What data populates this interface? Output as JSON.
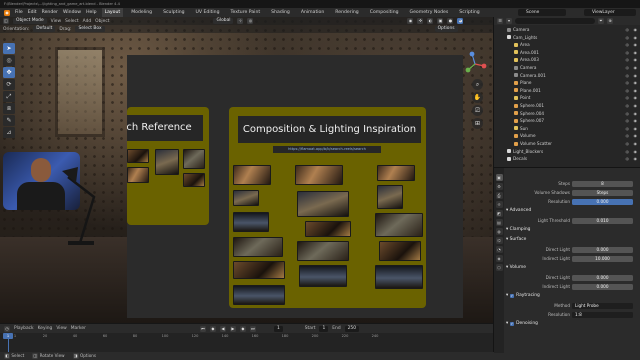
{
  "title_bar": "F:\\Blender\\Projects\\...\\lighting_and_game_art.blend - Blender 4.4",
  "menu": {
    "items": [
      "File",
      "Edit",
      "Render",
      "Window",
      "Help"
    ],
    "workspaces": [
      "Layout",
      "Modeling",
      "Sculpting",
      "UV Editing",
      "Texture Paint",
      "Shading",
      "Animation",
      "Rendering",
      "Compositing",
      "Geometry Nodes",
      "Scripting"
    ],
    "active_workspace": "Layout",
    "scene": "Scene",
    "view_layer": "ViewLayer"
  },
  "viewport": {
    "header1": {
      "mode": "Object Mode",
      "menus": [
        "View",
        "Select",
        "Add",
        "Object"
      ],
      "transform": "Global"
    },
    "header2": {
      "orientation_label": "Orientation:",
      "orientation_value": "Default",
      "drag_label": "Drag:",
      "drag_value": "Select Box",
      "options": "Options"
    },
    "tools": [
      "➤",
      "◎",
      "✥",
      "⟳",
      "⤢",
      "⧈",
      "✎",
      "⊿"
    ]
  },
  "reference_board": {
    "left_title": "nch Reference",
    "right_title": "Composition & Lighting Inspiration",
    "right_link": "https://flamoat.app/b/b/search-reels/search"
  },
  "timeline": {
    "menus": [
      "Playback",
      "Keying",
      "View",
      "Marker"
    ],
    "current_frame": "1",
    "start_label": "Start",
    "start_value": "1",
    "end_label": "End",
    "end_value": "250",
    "ruler": [
      "1",
      "20",
      "40",
      "60",
      "80",
      "100",
      "120",
      "140",
      "160",
      "180",
      "200",
      "220",
      "240"
    ]
  },
  "status_bar": {
    "items": [
      "Select",
      "Rotate View",
      "Options"
    ]
  },
  "outliner": {
    "rows": [
      {
        "name": "Camera",
        "color": "#8b8b8b",
        "indent": 1
      },
      {
        "name": "Cam_Lights",
        "color": "#d9d9d9",
        "indent": 1
      },
      {
        "name": "Area",
        "color": "#e2c25a",
        "indent": 2
      },
      {
        "name": "Area.001",
        "color": "#e2c25a",
        "indent": 2
      },
      {
        "name": "Area.003",
        "color": "#e2c25a",
        "indent": 2
      },
      {
        "name": "Camera",
        "color": "#8b8b8b",
        "indent": 2
      },
      {
        "name": "Camera.001",
        "color": "#8b8b8b",
        "indent": 2
      },
      {
        "name": "Plane",
        "color": "#e2a04a",
        "indent": 2
      },
      {
        "name": "Plane.001",
        "color": "#e2a04a",
        "indent": 2
      },
      {
        "name": "Point",
        "color": "#e2c25a",
        "indent": 2
      },
      {
        "name": "Sphere.001",
        "color": "#e2a04a",
        "indent": 2
      },
      {
        "name": "Sphere.004",
        "color": "#e2a04a",
        "indent": 2
      },
      {
        "name": "Sphere.007",
        "color": "#e2a04a",
        "indent": 2
      },
      {
        "name": "Sun",
        "color": "#e2c25a",
        "indent": 2
      },
      {
        "name": "Volume",
        "color": "#e2a04a",
        "indent": 2
      },
      {
        "name": "Volume Scatter",
        "color": "#e2a04a",
        "indent": 2
      },
      {
        "name": "Light_Blockers",
        "color": "#d9d9d9",
        "indent": 1
      },
      {
        "name": "Decals",
        "color": "#d9d9d9",
        "indent": 1
      }
    ]
  },
  "properties": {
    "tabs": [
      "▣",
      "⚙",
      "⎙",
      "☼",
      "◩",
      "▤",
      "◍",
      "⌬",
      "◔",
      "◈",
      "⬡"
    ],
    "rows": [
      {
        "kind": "field",
        "label": "Steps",
        "value": "8",
        "style": "normal"
      },
      {
        "kind": "field",
        "label": "Volume Shadows",
        "value": "Steps",
        "style": "normal"
      },
      {
        "kind": "field",
        "label": "Resolution",
        "value": "0.000",
        "style": "blue"
      },
      {
        "kind": "section",
        "label": "Advanced"
      },
      {
        "kind": "field",
        "label": "Light Threshold",
        "value": "0.010",
        "style": "normal"
      },
      {
        "kind": "section",
        "label": "Clamping"
      },
      {
        "kind": "section",
        "label": "Surface"
      },
      {
        "kind": "field",
        "label": "Direct Light",
        "value": "0.000",
        "style": "normal"
      },
      {
        "kind": "field",
        "label": "Indirect Light",
        "value": "10.000",
        "style": "normal"
      },
      {
        "kind": "section",
        "label": "Volume"
      },
      {
        "kind": "field",
        "label": "Direct Light",
        "value": "0.000",
        "style": "normal"
      },
      {
        "kind": "field",
        "label": "Indirect Light",
        "value": "0.000",
        "style": "normal"
      },
      {
        "kind": "check",
        "label": "Raytracing"
      },
      {
        "kind": "field",
        "label": "Method",
        "value": "Light Probe",
        "style": "dark"
      },
      {
        "kind": "field",
        "label": "Resolution",
        "value": "1:8",
        "style": "dark"
      },
      {
        "kind": "check",
        "label": "Denoising"
      }
    ]
  }
}
